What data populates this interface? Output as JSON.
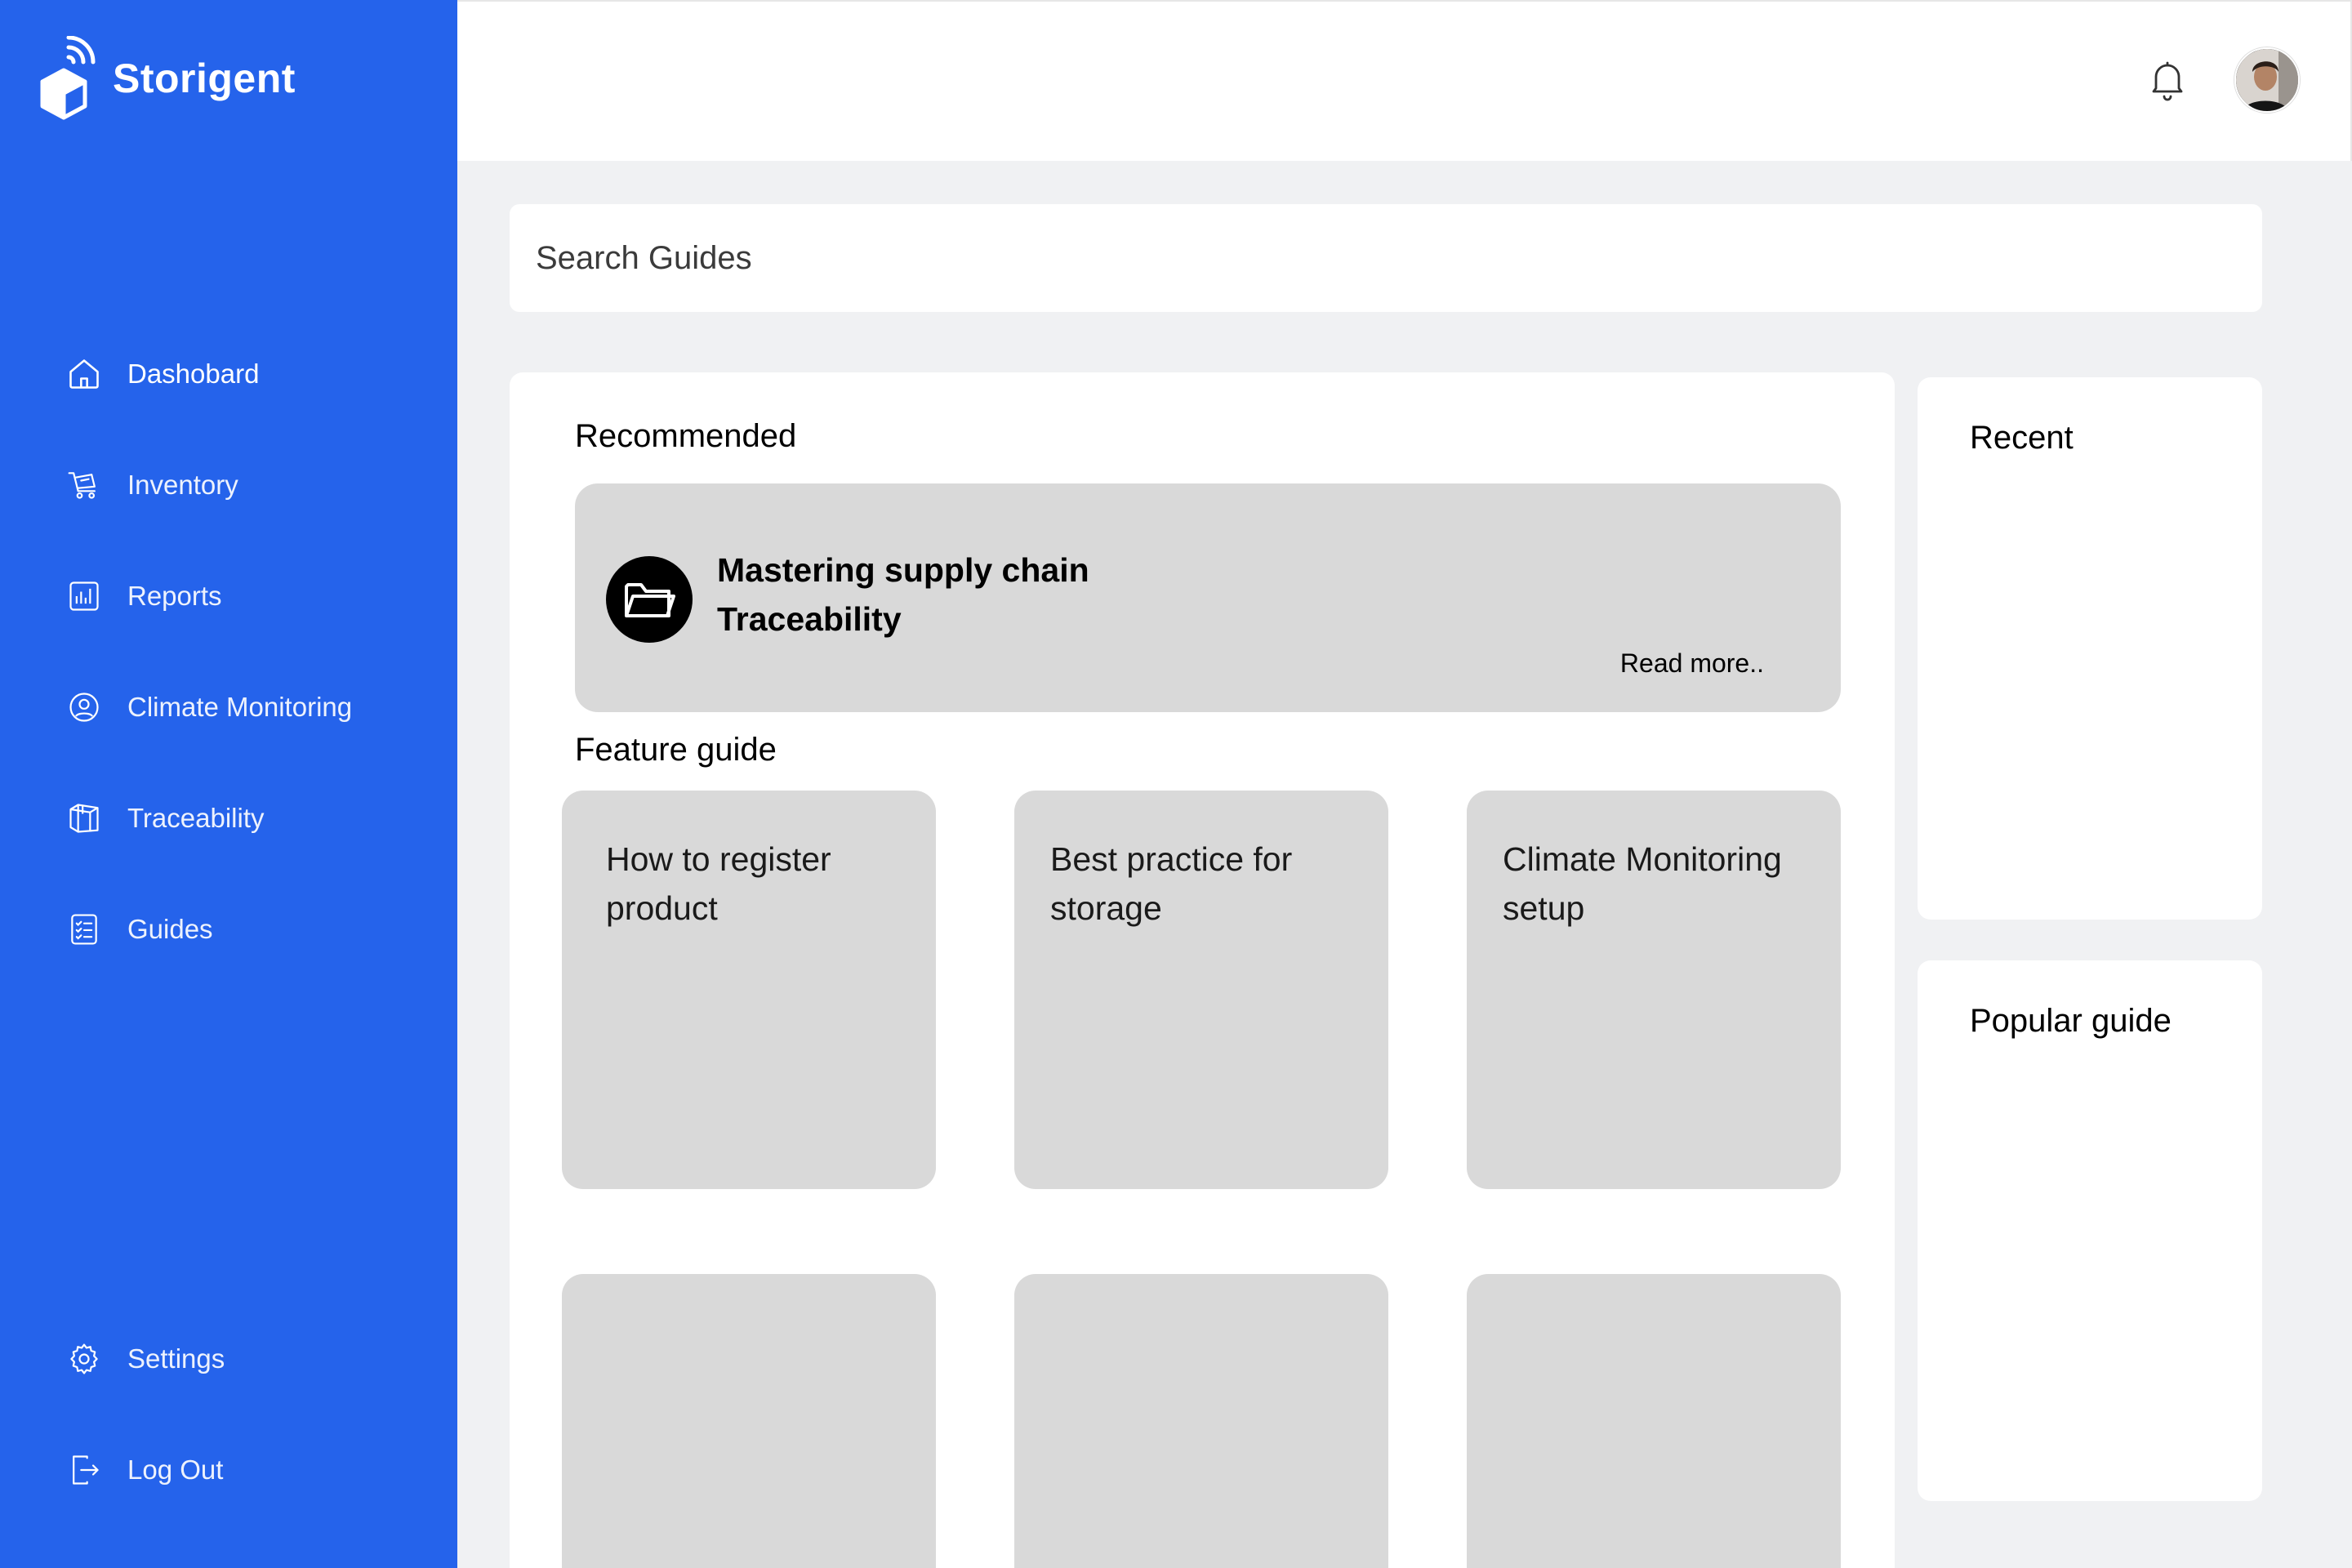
{
  "brand": {
    "name": "Storigent"
  },
  "sidebar": {
    "items": [
      {
        "label": "Dashobard",
        "icon": "home-icon"
      },
      {
        "label": "Inventory",
        "icon": "cart-icon"
      },
      {
        "label": "Reports",
        "icon": "bar-chart-icon"
      },
      {
        "label": "Climate Monitoring",
        "icon": "user-circle-icon"
      },
      {
        "label": "Traceability",
        "icon": "box-icon"
      },
      {
        "label": "Guides",
        "icon": "checklist-icon"
      }
    ],
    "bottom": [
      {
        "label": "Settings",
        "icon": "gear-icon"
      },
      {
        "label": "Log Out",
        "icon": "logout-icon"
      }
    ]
  },
  "header": {
    "notifications_icon": "bell-icon",
    "avatar": "user-avatar"
  },
  "search": {
    "placeholder": "Search Guides"
  },
  "main": {
    "recommended": {
      "heading": "Recommended",
      "card": {
        "title_line1": "Mastering supply chain",
        "title_line2": "Traceability",
        "link": "Read more.."
      }
    },
    "feature": {
      "heading": "Feature guide",
      "cards": [
        {
          "line1": "How to register",
          "line2": "product"
        },
        {
          "line1": "Best practice for",
          "line2": "storage"
        },
        {
          "line1": "Climate Monitoring",
          "line2": "setup"
        }
      ]
    }
  },
  "right": {
    "recent": {
      "title": "Recent"
    },
    "popular": {
      "title": "Popular guide"
    }
  },
  "colors": {
    "sidebar_bg": "#2563eb",
    "page_bg": "#f0f1f3",
    "card_bg": "#d9d9d9"
  }
}
